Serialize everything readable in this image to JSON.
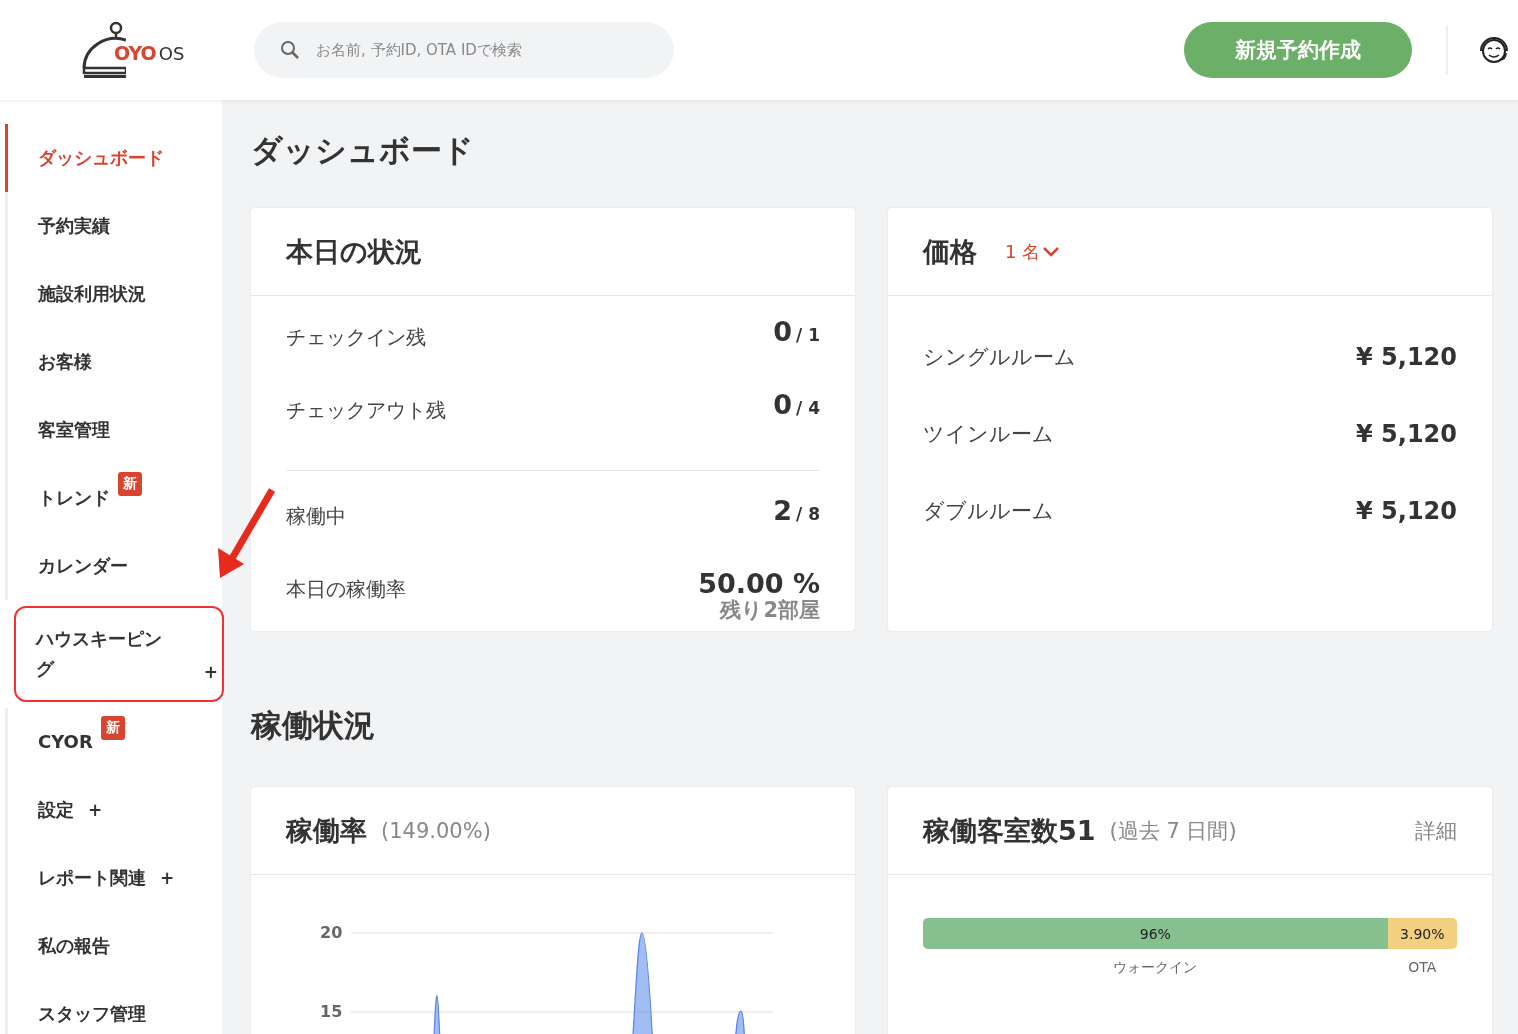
{
  "header": {
    "logo": {
      "brand": "OYO",
      "suffix": "OS"
    },
    "search": {
      "placeholder": "お名前, 予約ID, OTA IDで検索"
    },
    "new_booking_button": "新規予約作成"
  },
  "sidebar": {
    "items": [
      {
        "label": "ダッシュボード",
        "selected": true,
        "annotated": false
      },
      {
        "label": "予約実績",
        "selected": false,
        "annotated": false
      },
      {
        "label": "施設利用状況",
        "selected": false,
        "annotated": false
      },
      {
        "label": "お客様",
        "selected": false,
        "annotated": false
      },
      {
        "label": "客室管理",
        "selected": false,
        "annotated": false
      },
      {
        "label": "トレンド",
        "badge": "新",
        "selected": false,
        "annotated": false
      },
      {
        "label": "カレンダー",
        "selected": false,
        "annotated": false
      },
      {
        "label": "ハウスキーピング",
        "toggle": "+",
        "selected": false,
        "annotated": true
      },
      {
        "label": "CYOR",
        "badge": "新",
        "selected": false,
        "annotated": false
      },
      {
        "label": "設定",
        "toggle": "+",
        "selected": false,
        "annotated": false
      },
      {
        "label": "レポート関連",
        "toggle": "+",
        "selected": false,
        "annotated": false
      },
      {
        "label": "私の報告",
        "selected": false,
        "annotated": false
      },
      {
        "label": "スタッフ管理",
        "selected": false,
        "annotated": false
      }
    ]
  },
  "page_title": "ダッシュボード",
  "today": {
    "title": "本日の状況",
    "groups": [
      [
        {
          "label": "チェックイン残",
          "value": "0",
          "total": "/ 1"
        },
        {
          "label": "チェックアウト残",
          "value": "0",
          "total": "/ 4"
        }
      ],
      [
        {
          "label": "稼働中",
          "value": "2",
          "total": "/ 8"
        },
        {
          "label": "本日の稼働率",
          "value": "50.00 %",
          "note": "残り2部屋"
        }
      ]
    ]
  },
  "prices": {
    "title": "価格",
    "guests": "1 名",
    "rows": [
      {
        "label": "シングルルーム",
        "price": "¥ 5,120"
      },
      {
        "label": "ツインルーム",
        "price": "¥ 5,120"
      },
      {
        "label": "ダブルルーム",
        "price": "¥ 5,120"
      }
    ]
  },
  "section_title": "稼働状況",
  "occupancy_card": {
    "title": "稼働率",
    "subtitle": "(149.00%)",
    "axis_labels": [
      "20",
      "15"
    ]
  },
  "rooms_card": {
    "title": "稼働客室数51",
    "subtitle": "(過去 7 日間)",
    "link": "詳細",
    "segments": [
      {
        "value": "96%",
        "legend": "ウォークイン",
        "level": 0.87,
        "color": "#86c08f"
      },
      {
        "value": "3.90%",
        "legend": "OTA",
        "color": "#f3d07f"
      }
    ]
  }
}
